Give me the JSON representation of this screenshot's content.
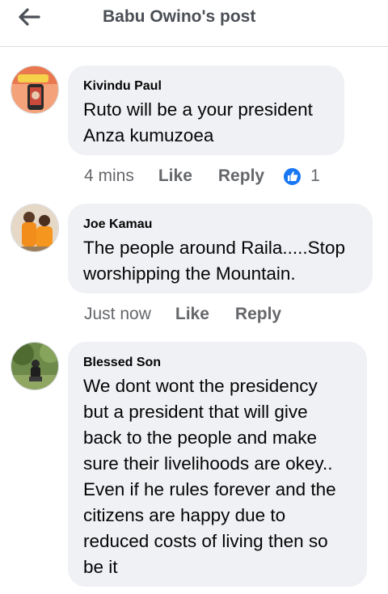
{
  "header": {
    "title": "Babu Owino's post",
    "back_icon": "arrow-left-icon"
  },
  "comments": [
    {
      "author": "Kivindu Paul",
      "text": "Ruto will be a your president\nAnza kumuzoea",
      "time": "4 mins",
      "like_label": "Like",
      "reply_label": "Reply",
      "reaction_icon": "thumbs-up-icon",
      "reaction_count": "1"
    },
    {
      "author": "Joe Kamau",
      "text": "The people around Raila.....Stop\nworshipping the Mountain.",
      "time": "Just now",
      "like_label": "Like",
      "reply_label": "Reply"
    },
    {
      "author": "Blessed Son",
      "text": "We dont wont the presidency\nbut a president that will give\nback to the people and make\nsure their livelihoods are okey..\nEven if he rules forever and the\ncitizens are happy due to\nreduced costs of living then so\nbe it"
    }
  ],
  "colors": {
    "bubble": "#eff1f4",
    "secondary_text": "#65676b",
    "reaction_blue": "#1877f2"
  }
}
